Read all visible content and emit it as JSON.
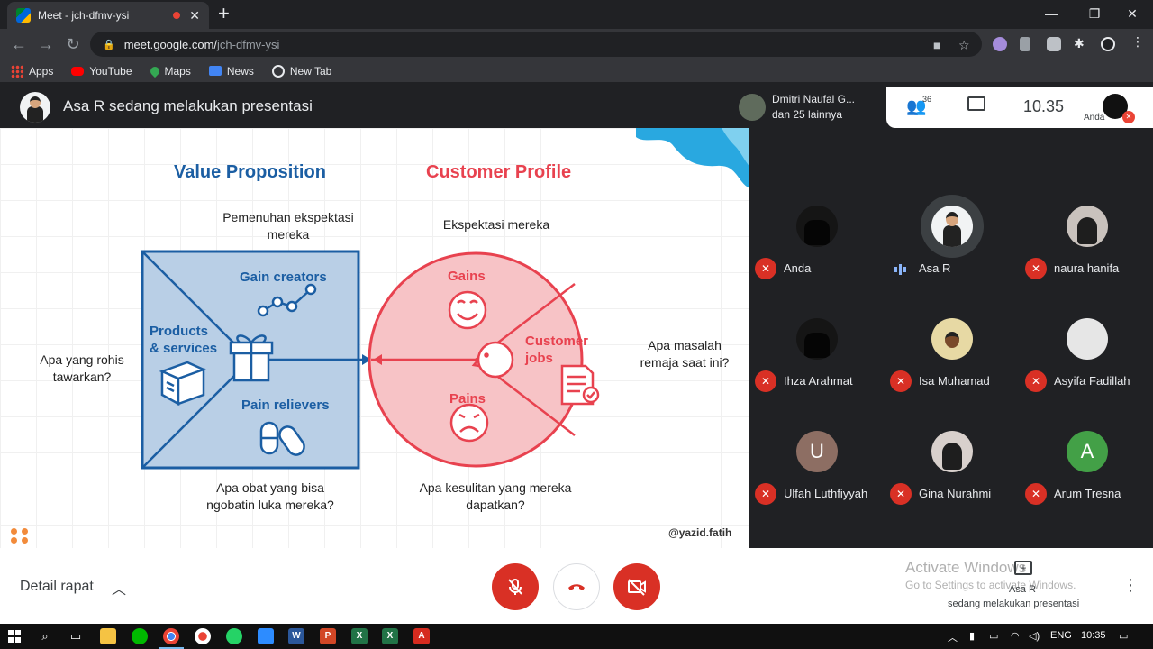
{
  "browser": {
    "tab_title": "Meet - jch-dfmv-ysi",
    "url_host": "meet.google.com/",
    "url_path": "jch-dfmv-ysi",
    "bookmarks": [
      {
        "label": "Apps",
        "icon": "apps-grid-icon"
      },
      {
        "label": "YouTube",
        "icon": "youtube-icon"
      },
      {
        "label": "Maps",
        "icon": "maps-icon"
      },
      {
        "label": "News",
        "icon": "news-icon"
      },
      {
        "label": "New Tab",
        "icon": "new-tab-icon"
      }
    ]
  },
  "meet": {
    "presenting_text": "Asa R sedang melakukan presentasi",
    "viewer_name": "Dmitri Naufal G...",
    "viewer_sub": "dan 25 lainnya",
    "participant_count": "36",
    "clock": "10.35",
    "self_label": "Anda"
  },
  "slide": {
    "title_vp": "Value Proposition",
    "title_cp": "Customer Profile",
    "q_expectation_fulfill": "Pemenuhan ekspektasi\nmereka",
    "q_expectation": "Ekspektasi mereka",
    "q_offer": "Apa yang rohis\ntawarkan?",
    "q_problem": "Apa masalah\nremaja saat ini?",
    "q_medicine": "Apa obat yang bisa\nngobatin luka mereka?",
    "q_difficulty": "Apa kesulitan yang mereka\ndapatkan?",
    "gain_creators": "Gain creators",
    "products_services": "Products\n& services",
    "pain_relievers": "Pain relievers",
    "gains": "Gains",
    "pains": "Pains",
    "customer_jobs": "Customer\njobs",
    "handle": "@yazid.fatih",
    "colors": {
      "blue": "#1b5ea3",
      "blue_fill": "#b9cfe6",
      "red": "#e8424f",
      "red_fill": "#f7c3c6"
    }
  },
  "participants": [
    {
      "name": "Anda",
      "muted": true,
      "avatar": "dark-photo",
      "color": "#151515"
    },
    {
      "name": "Asa R",
      "muted": false,
      "avatar": "presenter-photo",
      "color": "#f1f3f4"
    },
    {
      "name": "naura hanifa",
      "muted": true,
      "avatar": "hijab-photo",
      "color": "#c9c2bd"
    },
    {
      "name": "Ihza Arahmat",
      "muted": true,
      "avatar": "dark-photo",
      "color": "#151515"
    },
    {
      "name": "Isa Muhamad",
      "muted": true,
      "avatar": "yellow-photo",
      "color": "#e7d9a4"
    },
    {
      "name": "Asyifa Fadillah",
      "muted": true,
      "avatar": "marble-photo",
      "color": "#e6e6e6"
    },
    {
      "name": "Ulfah Luthfiyyah",
      "muted": true,
      "avatar": "letter",
      "letter": "U",
      "color": "#8d6e63"
    },
    {
      "name": "Gina Nurahmi",
      "muted": true,
      "avatar": "hijab-photo",
      "color": "#d8d0cc"
    },
    {
      "name": "Arum Tresna",
      "muted": true,
      "avatar": "letter",
      "letter": "A",
      "color": "#43a047"
    }
  ],
  "bottom_bar": {
    "meeting_details": "Detail rapat",
    "activate_title": "Activate Windows",
    "activate_sub": "Go to Settings to activate Windows.",
    "presenter_name": "Asa R",
    "presenter_desc": "sedang melakukan presentasi"
  },
  "taskbar": {
    "lang": "ENG",
    "time": "10:35"
  }
}
